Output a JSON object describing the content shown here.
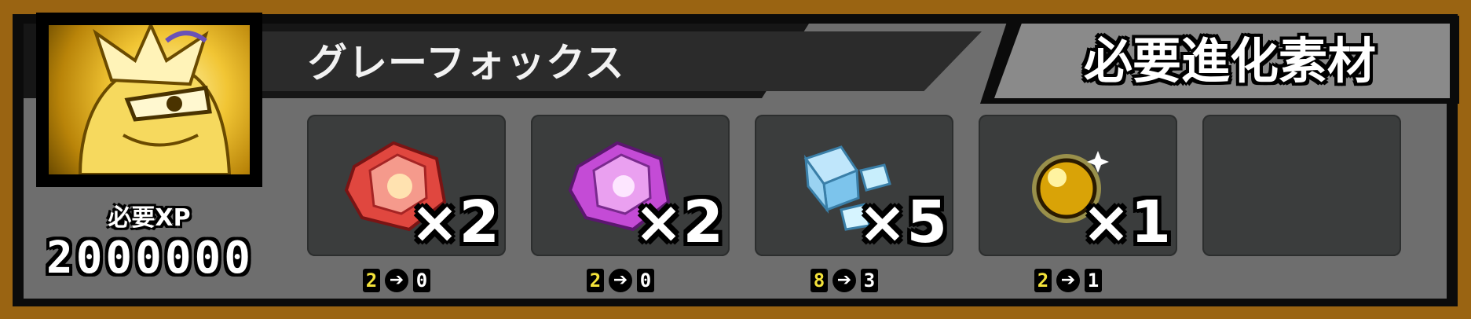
{
  "unit": {
    "name": "グレーフォックス",
    "xp_label": "必要XP",
    "xp_value": "2000000"
  },
  "panel": {
    "title": "必要進化素材"
  },
  "materials": [
    {
      "icon": "red-gem-icon",
      "qty": "×2",
      "from": "2",
      "arrow": "➔",
      "to": "0"
    },
    {
      "icon": "purple-gem-icon",
      "qty": "×2",
      "from": "2",
      "arrow": "➔",
      "to": "0"
    },
    {
      "icon": "ice-crystal-icon",
      "qty": "×5",
      "from": "8",
      "arrow": "➔",
      "to": "3"
    },
    {
      "icon": "gold-orb-icon",
      "qty": "×1",
      "from": "2",
      "arrow": "➔",
      "to": "1"
    }
  ],
  "colors": {
    "background": "#9a6412",
    "panel": "#6e6e6e",
    "slot": "#3b3d3d",
    "stock_number": "#f3e23a"
  }
}
